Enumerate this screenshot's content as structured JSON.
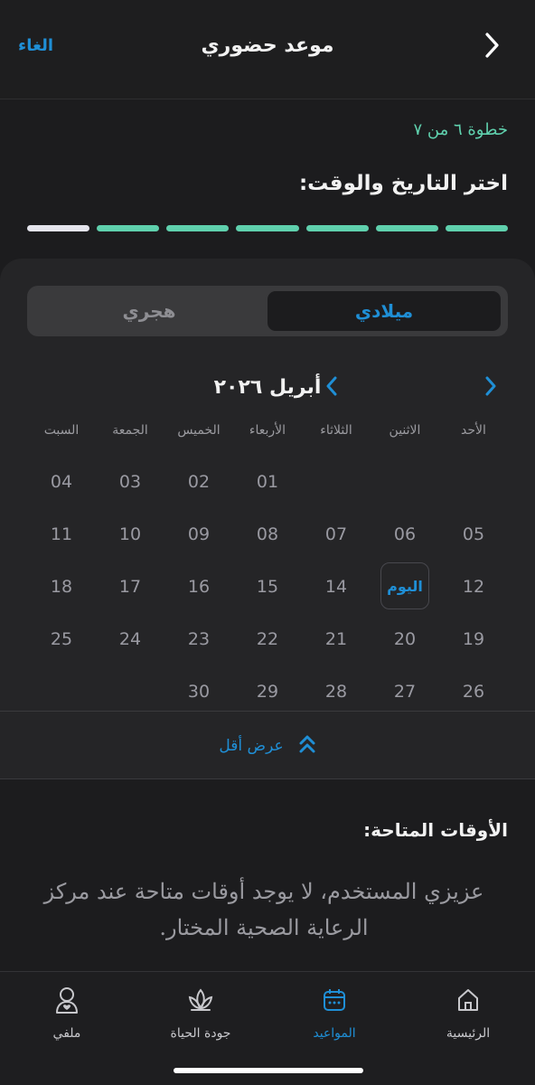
{
  "header": {
    "title": "موعد حضوري",
    "cancel_label": "الغاء",
    "back_icon": "chevron-right-icon"
  },
  "wizard": {
    "step_text": "خطوة ٦ من ٧",
    "heading": "اختر التاريخ والوقت:",
    "total_steps": 7,
    "completed_steps": 6
  },
  "calendar_type": {
    "options": [
      "ميلادي",
      "هجري"
    ],
    "selected": "ميلادي"
  },
  "calendar": {
    "month_label": "أبريل ٢٠٢٦",
    "weekdays": [
      "الأحد",
      "الاثنين",
      "الثلاثاء",
      "الأربعاء",
      "الخميس",
      "الجمعة",
      "السبت"
    ],
    "today_label": "اليوم",
    "weeks": [
      [
        "",
        "",
        "",
        "01",
        "02",
        "03",
        "04"
      ],
      [
        "05",
        "06",
        "07",
        "08",
        "09",
        "10",
        "11"
      ],
      [
        "12",
        "اليوم",
        "14",
        "15",
        "16",
        "17",
        "18"
      ],
      [
        "19",
        "20",
        "21",
        "22",
        "23",
        "24",
        "25"
      ],
      [
        "26",
        "27",
        "28",
        "29",
        "30",
        "",
        ""
      ]
    ],
    "show_less_label": "عرض أقل"
  },
  "available_times": {
    "title": "الأوقات المتاحة:",
    "empty_message": "عزيزي المستخدم، لا يوجد أوقات متاحة عند مركز الرعاية الصحية المختار."
  },
  "tabbar": {
    "items": [
      {
        "label": "الرئيسية",
        "icon": "home-icon"
      },
      {
        "label": "المواعيد",
        "icon": "calendar-icon",
        "active": true
      },
      {
        "label": "جودة الحياة",
        "icon": "lotus-icon"
      },
      {
        "label": "ملفي",
        "icon": "profile-icon"
      }
    ]
  },
  "colors": {
    "accent": "#1f8fd6",
    "progress": "#5fd0ad",
    "background": "#1c1c1e"
  }
}
